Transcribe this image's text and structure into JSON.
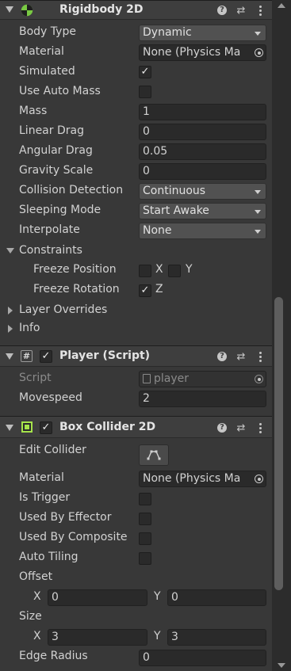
{
  "rigidbody": {
    "title": "Rigidbody 2D",
    "icon": "rigidbody2d-icon",
    "fields": {
      "body_type": {
        "label": "Body Type",
        "value": "Dynamic"
      },
      "material": {
        "label": "Material",
        "value": "None (Physics Ma"
      },
      "simulated": {
        "label": "Simulated",
        "checked": "✓"
      },
      "use_auto_mass": {
        "label": "Use Auto Mass",
        "checked": ""
      },
      "mass": {
        "label": "Mass",
        "value": "1"
      },
      "linear_drag": {
        "label": "Linear Drag",
        "value": "0"
      },
      "angular_drag": {
        "label": "Angular Drag",
        "value": "0.05"
      },
      "gravity_scale": {
        "label": "Gravity Scale",
        "value": "0"
      },
      "collision_detection": {
        "label": "Collision Detection",
        "value": "Continuous"
      },
      "sleeping_mode": {
        "label": "Sleeping Mode",
        "value": "Start Awake"
      },
      "interpolate": {
        "label": "Interpolate",
        "value": "None"
      }
    },
    "constraints": {
      "label": "Constraints",
      "freeze_position": {
        "label": "Freeze Position",
        "x_label": "X",
        "x_checked": "",
        "y_label": "Y",
        "y_checked": ""
      },
      "freeze_rotation": {
        "label": "Freeze Rotation",
        "z_label": "Z",
        "z_checked": "✓"
      }
    },
    "layer_overrides": "Layer Overrides",
    "info": "Info"
  },
  "player_script": {
    "title": "Player (Script)",
    "icon": "script-icon",
    "enabled": "✓",
    "script": {
      "label": "Script",
      "value": "player"
    },
    "movespeed": {
      "label": "Movespeed",
      "value": "2"
    }
  },
  "box_collider": {
    "title": "Box Collider 2D",
    "icon": "box-collider-icon",
    "enabled": "✓",
    "edit_collider": {
      "label": "Edit Collider"
    },
    "material": {
      "label": "Material",
      "value": "None (Physics Ma"
    },
    "is_trigger": {
      "label": "Is Trigger",
      "checked": ""
    },
    "used_by_effector": {
      "label": "Used By Effector",
      "checked": ""
    },
    "used_by_composite": {
      "label": "Used By Composite",
      "checked": ""
    },
    "auto_tiling": {
      "label": "Auto Tiling",
      "checked": ""
    },
    "offset": {
      "label": "Offset",
      "x_label": "X",
      "x": "0",
      "y_label": "Y",
      "y": "0"
    },
    "size": {
      "label": "Size",
      "x_label": "X",
      "x": "3",
      "y_label": "Y",
      "y": "3"
    },
    "edge_radius": {
      "label": "Edge Radius",
      "value": "0"
    }
  },
  "colors": {
    "panel_bg": "#383838",
    "header_bg": "#3e3e3e",
    "field_bg": "#2a2a2a",
    "dropdown_bg": "#515151",
    "rigidbody_icon": "#79c943",
    "collider_icon": "#a6e34b"
  }
}
